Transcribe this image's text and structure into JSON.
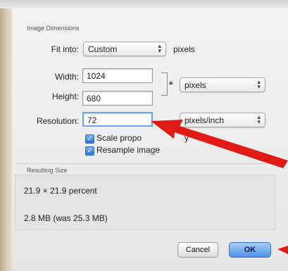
{
  "dialog": {
    "section_dimensions": "Image Dimensions",
    "fit_into_label": "Fit into:",
    "fit_into_value": "Custom",
    "fit_into_unit": "pixels",
    "width_label": "Width:",
    "width_value": "1024",
    "height_label": "Height:",
    "height_value": "680",
    "size_unit": "pixels",
    "resolution_label": "Resolution:",
    "resolution_value": "72",
    "resolution_unit": "pixels/inch",
    "scale_label": "Scale propo",
    "scale_label_tail": "y",
    "scale_checked": true,
    "resample_label": "Resample image",
    "resample_checked": true,
    "section_result": "Resulting Size",
    "percent_text": "21.9 × 21.9 percent",
    "size_text": "2.8 MB (was 25.3 MB)",
    "cancel_label": "Cancel",
    "ok_label": "OK"
  },
  "colors": {
    "accent": "#4f90e6",
    "annotation_arrow": "#e01a14"
  },
  "icons": {
    "lock": "lock-icon",
    "checkmark": "checkmark-icon",
    "popup_arrows": "up-down-arrows-icon"
  }
}
